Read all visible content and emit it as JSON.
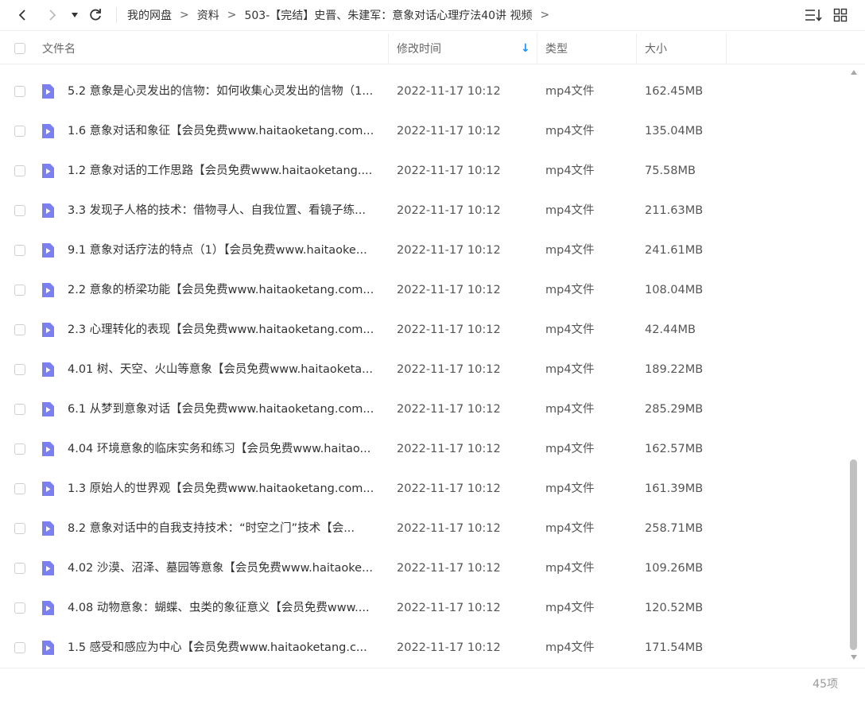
{
  "toolbar": {
    "icons": [
      "back-icon",
      "forward-icon",
      "history-dropdown-icon",
      "refresh-icon",
      "sort-list-icon",
      "grid-view-icon"
    ],
    "breadcrumb": [
      "我的网盘",
      "资料",
      "503-【完结】史晋、朱建军：意象对话心理疗法40讲 视频"
    ],
    "separator": ">"
  },
  "columns": {
    "name": "文件名",
    "modified": "修改时间",
    "type": "类型",
    "size": "大小",
    "sort_indicator": "↓"
  },
  "accent_color": "#1890ff",
  "file_icon_color": "#7b7ff0",
  "files": [
    {
      "name": "5.2 意象是心灵发出的信物：如何收集心灵发出的信物（1...",
      "modified": "2022-11-17 10:12",
      "type": "mp4文件",
      "size": "162.45MB"
    },
    {
      "name": "1.6 意象对话和象征【会员免费www.haitaoketang.com...",
      "modified": "2022-11-17 10:12",
      "type": "mp4文件",
      "size": "135.04MB"
    },
    {
      "name": "1.2 意象对话的工作思路【会员免费www.haitaoketang....",
      "modified": "2022-11-17 10:12",
      "type": "mp4文件",
      "size": "75.58MB"
    },
    {
      "name": "3.3 发现子人格的技术：借物寻人、自我位置、看镜子练...",
      "modified": "2022-11-17 10:12",
      "type": "mp4文件",
      "size": "211.63MB"
    },
    {
      "name": "9.1 意象对话疗法的特点（1）【会员免费www.haitaoke...",
      "modified": "2022-11-17 10:12",
      "type": "mp4文件",
      "size": "241.61MB"
    },
    {
      "name": "2.2 意象的桥梁功能【会员免费www.haitaoketang.com...",
      "modified": "2022-11-17 10:12",
      "type": "mp4文件",
      "size": "108.04MB"
    },
    {
      "name": "2.3 心理转化的表现【会员免费www.haitaoketang.com...",
      "modified": "2022-11-17 10:12",
      "type": "mp4文件",
      "size": "42.44MB"
    },
    {
      "name": "4.01 树、天空、火山等意象【会员免费www.haitaoketa...",
      "modified": "2022-11-17 10:12",
      "type": "mp4文件",
      "size": "189.22MB"
    },
    {
      "name": "6.1 从梦到意象对话【会员免费www.haitaoketang.com...",
      "modified": "2022-11-17 10:12",
      "type": "mp4文件",
      "size": "285.29MB"
    },
    {
      "name": "4.04 环境意象的临床实务和练习【会员免费www.haitao...",
      "modified": "2022-11-17 10:12",
      "type": "mp4文件",
      "size": "162.57MB"
    },
    {
      "name": "1.3 原始人的世界观【会员免费www.haitaoketang.com...",
      "modified": "2022-11-17 10:12",
      "type": "mp4文件",
      "size": "161.39MB"
    },
    {
      "name": "8.2 意象对话中的自我支持技术：“时空之门”技术【会...",
      "modified": "2022-11-17 10:12",
      "type": "mp4文件",
      "size": "258.71MB"
    },
    {
      "name": "4.02 沙漠、沼泽、墓园等意象【会员免费www.haitaoke...",
      "modified": "2022-11-17 10:12",
      "type": "mp4文件",
      "size": "109.26MB"
    },
    {
      "name": "4.08 动物意象：蝴蝶、虫类的象征意义【会员免费www....",
      "modified": "2022-11-17 10:12",
      "type": "mp4文件",
      "size": "120.52MB"
    },
    {
      "name": "1.5 感受和感应为中心【会员免费www.haitaoketang.c...",
      "modified": "2022-11-17 10:12",
      "type": "mp4文件",
      "size": "171.54MB"
    }
  ],
  "footer": {
    "count": "45项"
  }
}
